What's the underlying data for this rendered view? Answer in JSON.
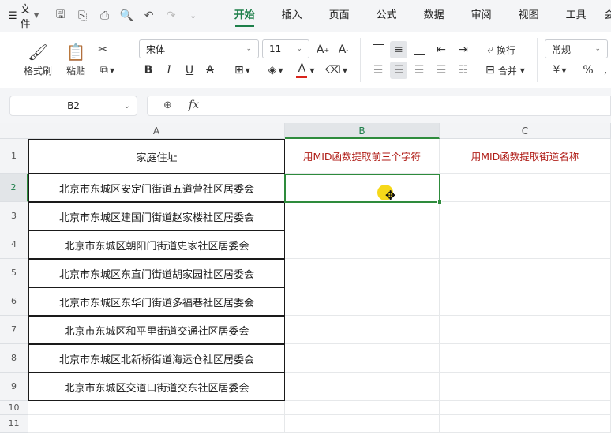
{
  "menubar": {
    "file_label": "文件",
    "menu_icon": "hamburger-icon",
    "tabs": [
      "开始",
      "插入",
      "页面",
      "公式",
      "数据",
      "审阅",
      "视图",
      "工具",
      "会"
    ],
    "active_tab": "开始"
  },
  "ribbon": {
    "format_painter": "格式刷",
    "paste": "粘贴",
    "font_name": "宋体",
    "font_size": "11",
    "wrap_text": "换行",
    "merge": "合并",
    "number_format": "常规",
    "currency_symbol": "¥",
    "percent_symbol": "%",
    "bold": "B",
    "italic": "I",
    "underline": "U",
    "font_color_letter": "A",
    "font_color": "#d9251c",
    "accent_color": "#1e7f4a"
  },
  "formulabar": {
    "name_box": "B2",
    "fx_label": "fx",
    "formula": ""
  },
  "grid": {
    "columns": [
      "A",
      "B",
      "C"
    ],
    "rows": [
      "1",
      "2",
      "3",
      "4",
      "5",
      "6",
      "7",
      "8",
      "9",
      "10",
      "11"
    ],
    "active_cell": "B2",
    "a1": "家庭住址",
    "b1": "用MID函数提取前三个字符",
    "c1": "用MID函数提取街道名称",
    "addresses": [
      "北京市东城区安定门街道五道营社区居委会",
      "北京市东城区建国门街道赵家楼社区居委会",
      "北京市东城区朝阳门街道史家社区居委会",
      "北京市东城区东直门街道胡家园社区居委会",
      "北京市东城区东华门街道多福巷社区居委会",
      "北京市东城区和平里街道交通社区居委会",
      "北京市东城区北新桥街道海运仓社区居委会",
      "北京市东城区交道口街道交东社区居委会"
    ]
  }
}
